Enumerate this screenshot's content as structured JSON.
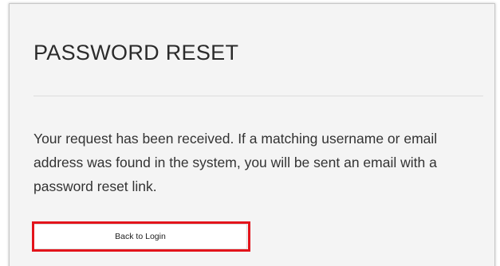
{
  "page": {
    "title": "PASSWORD RESET",
    "message": "Your request has been received. If a matching username or email address was found in the system, you will be sent an email with a password reset link.",
    "back_button_label": "Back to Login"
  },
  "colors": {
    "card_background": "#f4f4f4",
    "highlight": "#e3141b",
    "text": "#333333"
  }
}
